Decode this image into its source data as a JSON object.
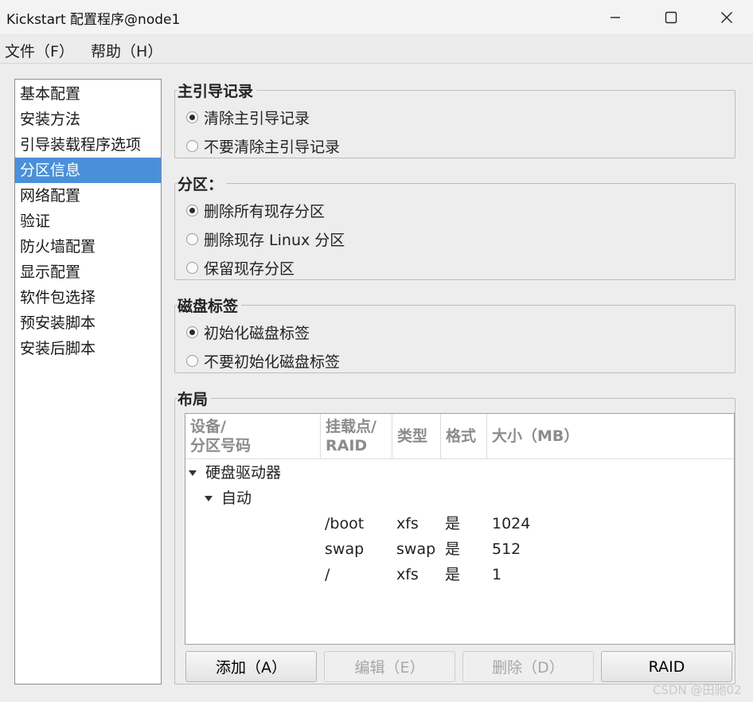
{
  "window": {
    "title": "Kickstart 配置程序@node1"
  },
  "menu": {
    "file": "文件（F）",
    "help": "帮助（H）"
  },
  "sidebar": {
    "items": [
      {
        "label": "基本配置"
      },
      {
        "label": "安装方法"
      },
      {
        "label": "引导装载程序选项"
      },
      {
        "label": "分区信息"
      },
      {
        "label": "网络配置"
      },
      {
        "label": "验证"
      },
      {
        "label": "防火墙配置"
      },
      {
        "label": "显示配置"
      },
      {
        "label": "软件包选择"
      },
      {
        "label": "预安装脚本"
      },
      {
        "label": "安装后脚本"
      }
    ],
    "selected": "分区信息"
  },
  "mbr": {
    "title": "主引导记录",
    "options": [
      "清除主引导记录",
      "不要清除主引导记录"
    ],
    "selected": "清除主引导记录"
  },
  "partitions": {
    "title": "分区：",
    "options": [
      "删除所有现存分区",
      "删除现存 Linux 分区",
      "保留现存分区"
    ],
    "selected": "删除所有现存分区"
  },
  "disklabel": {
    "title": "磁盘标签",
    "options": [
      "初始化磁盘标签",
      "不要初始化磁盘标签"
    ],
    "selected": "初始化磁盘标签"
  },
  "layout": {
    "title": "布局",
    "columns": {
      "device_line1": "设备/",
      "device_line2": "分区号码",
      "mount_line1": "挂载点/",
      "mount_line2": "RAID",
      "type": "类型",
      "format": "格式",
      "size": "大小（MB）"
    },
    "tree": {
      "disk": "硬盘驱动器",
      "auto": "自动"
    },
    "rows": [
      {
        "mount": "/boot",
        "type": "xfs",
        "format": "是",
        "size": "1024"
      },
      {
        "mount": "swap",
        "type": "swap",
        "format": "是",
        "size": "512"
      },
      {
        "mount": "/",
        "type": "xfs",
        "format": "是",
        "size": "1"
      }
    ]
  },
  "buttons": {
    "add": "添加（A）",
    "edit": "编辑（E）",
    "delete": "删除（D）",
    "raid": "RAID"
  },
  "watermark": "CSDN @田驰02",
  "icons": {
    "minimize": "minimize-icon",
    "maximize": "maximize-icon",
    "close": "close-icon"
  }
}
